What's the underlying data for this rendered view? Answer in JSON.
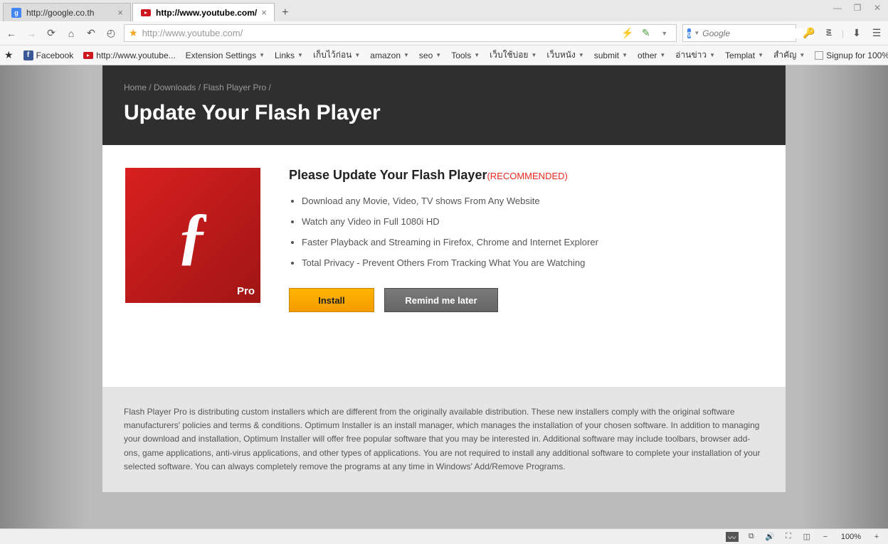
{
  "tabs": [
    {
      "label": "http://google.co.th",
      "favicon": "g"
    },
    {
      "label": "http://www.youtube.com/",
      "favicon": "yt",
      "active": true
    }
  ],
  "url": "http://www.youtube.com/",
  "search_placeholder": "Google",
  "bookmarks": [
    {
      "label": "Facebook",
      "icon": "fb"
    },
    {
      "label": "http://www.youtube...",
      "icon": "yt"
    },
    {
      "label": "Extension Settings",
      "dropdown": true
    },
    {
      "label": "Links",
      "dropdown": true
    },
    {
      "label": "เก็บไว้ก่อน",
      "dropdown": true
    },
    {
      "label": "amazon",
      "dropdown": true
    },
    {
      "label": "seo",
      "dropdown": true
    },
    {
      "label": "Tools",
      "dropdown": true
    },
    {
      "label": "เว็บใช้บ่อย",
      "dropdown": true
    },
    {
      "label": "เว็บหนัง",
      "dropdown": true
    },
    {
      "label": "submit",
      "dropdown": true
    },
    {
      "label": "other",
      "dropdown": true
    },
    {
      "label": "อ่านข่าว",
      "dropdown": true
    },
    {
      "label": "Templat",
      "dropdown": true
    },
    {
      "label": "สำคัญ",
      "dropdown": true
    },
    {
      "label": "Signup for 100%",
      "icon": "page"
    }
  ],
  "breadcrumbs": {
    "home": "Home",
    "downloads": "Downloads",
    "product": "Flash Player Pro",
    "sep": "/"
  },
  "page_title": "Update Your Flash Player",
  "subhead": "Please Update Your Flash Player",
  "recommended": "(RECOMMENDED)",
  "flash_pro": "Pro",
  "bullets": [
    "Download any Movie, Video, TV shows From Any Website",
    "Watch any Video in Full 1080i HD",
    "Faster Playback and Streaming in Firefox, Chrome and Internet Explorer",
    "Total Privacy - Prevent Others From Tracking What You are Watching"
  ],
  "btn_install": "Install",
  "btn_later": "Remind me later",
  "disclaimer": "Flash Player Pro is distributing custom installers which are different from the originally available distribution. These new installers comply with the original software manufacturers' policies and terms & conditions. Optimum Installer is an install manager, which manages the installation of your chosen software. In addition to managing your download and installation, Optimum Installer will offer free popular software that you may be interested in. Additional software may include toolbars, browser add-ons, game applications, anti-virus applications, and other types of applications. You are not required to install any additional software to complete your installation of your selected software. You can always completely remove the programs at any time in Windows' Add/Remove Programs.",
  "zoom": "100%"
}
